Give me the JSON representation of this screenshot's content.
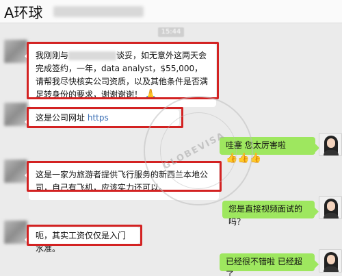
{
  "header": {
    "title": "A环球"
  },
  "time_badge": "15:44",
  "messages": [
    {
      "text_a": "我刚刚与",
      "text_b": "谈妥，如无意外这两天会完成签约，一年，data analyst，$55,000，请帮我尽快核实公司资质，以及其他条件是否满足转身份的要求，谢谢谢谢！",
      "emoji": "🙏"
    },
    {
      "text": "这是公司网址",
      "link": "https"
    },
    {
      "text": "哇塞 您太厉害啦",
      "emojis": "👍👍👍"
    },
    {
      "text": "这是一家为旅游者提供飞行服务的新西兰本地公司，自己有飞机，应该实力还可以。"
    },
    {
      "text": "您是直接视频面试的吗？"
    },
    {
      "text": "呃，其实工资仅仅是入门水准。"
    },
    {
      "text": "已经很不错啦 已经超了"
    }
  ],
  "watermark": {
    "text": "GLOBEVISA"
  },
  "colors": {
    "highlight": "#d32222",
    "bubble_right": "#9ee75f",
    "link": "#3a6fb5"
  }
}
